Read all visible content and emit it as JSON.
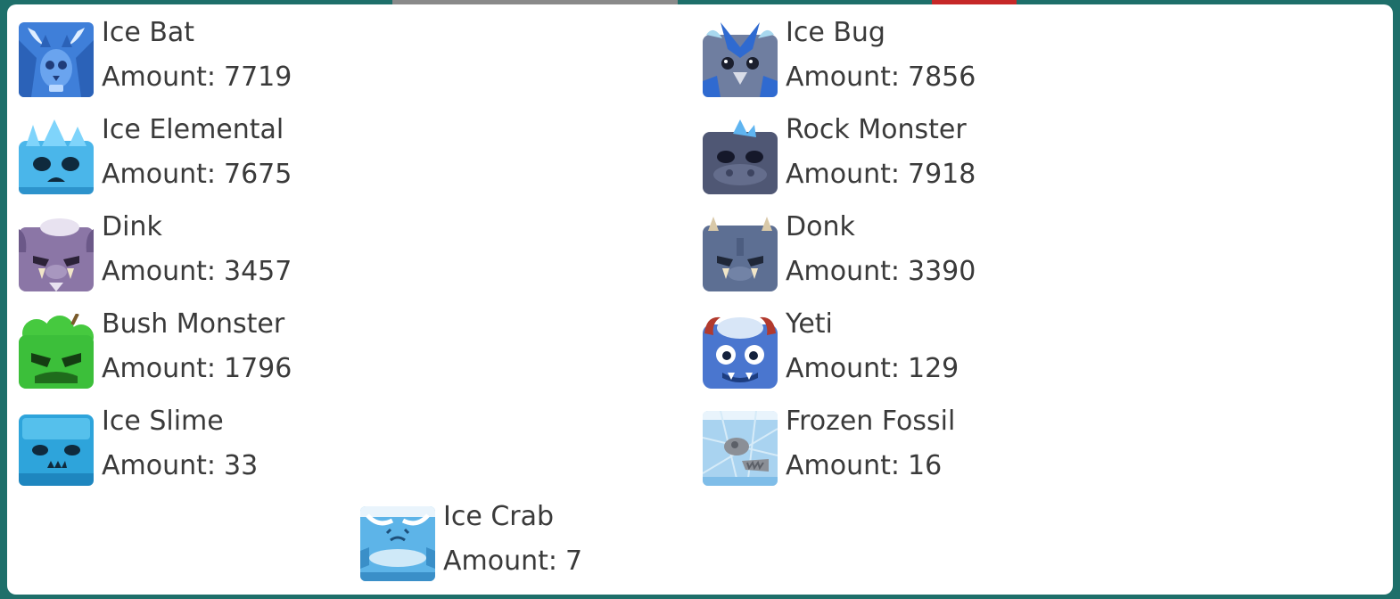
{
  "amount_label": "Amount:",
  "creatures": [
    {
      "name": "Ice Bat",
      "amount": "7719",
      "icon": "ice-bat-icon",
      "color": "#3f7fd9"
    },
    {
      "name": "Ice Bug",
      "amount": "7856",
      "icon": "ice-bug-icon",
      "color": "#6f7ea0"
    },
    {
      "name": "Ice Elemental",
      "amount": "7675",
      "icon": "ice-elemental-icon",
      "color": "#4ab6ea"
    },
    {
      "name": "Rock Monster",
      "amount": "7918",
      "icon": "rock-monster-icon",
      "color": "#4f5774"
    },
    {
      "name": "Dink",
      "amount": "3457",
      "icon": "dink-icon",
      "color": "#8b76a6"
    },
    {
      "name": "Donk",
      "amount": "3390",
      "icon": "donk-icon",
      "color": "#5d6f93"
    },
    {
      "name": "Bush Monster",
      "amount": "1796",
      "icon": "bush-monster-icon",
      "color": "#3cbf3a"
    },
    {
      "name": "Yeti",
      "amount": "129",
      "icon": "yeti-icon",
      "color": "#4a76cf"
    },
    {
      "name": "Ice Slime",
      "amount": "33",
      "icon": "ice-slime-icon",
      "color": "#2ea4db"
    },
    {
      "name": "Frozen Fossil",
      "amount": "16",
      "icon": "frozen-fossil-icon",
      "color": "#a9d3f0"
    },
    {
      "name": "Ice Crab",
      "amount": "7",
      "icon": "ice-crab-icon",
      "color": "#5db4e8"
    }
  ]
}
